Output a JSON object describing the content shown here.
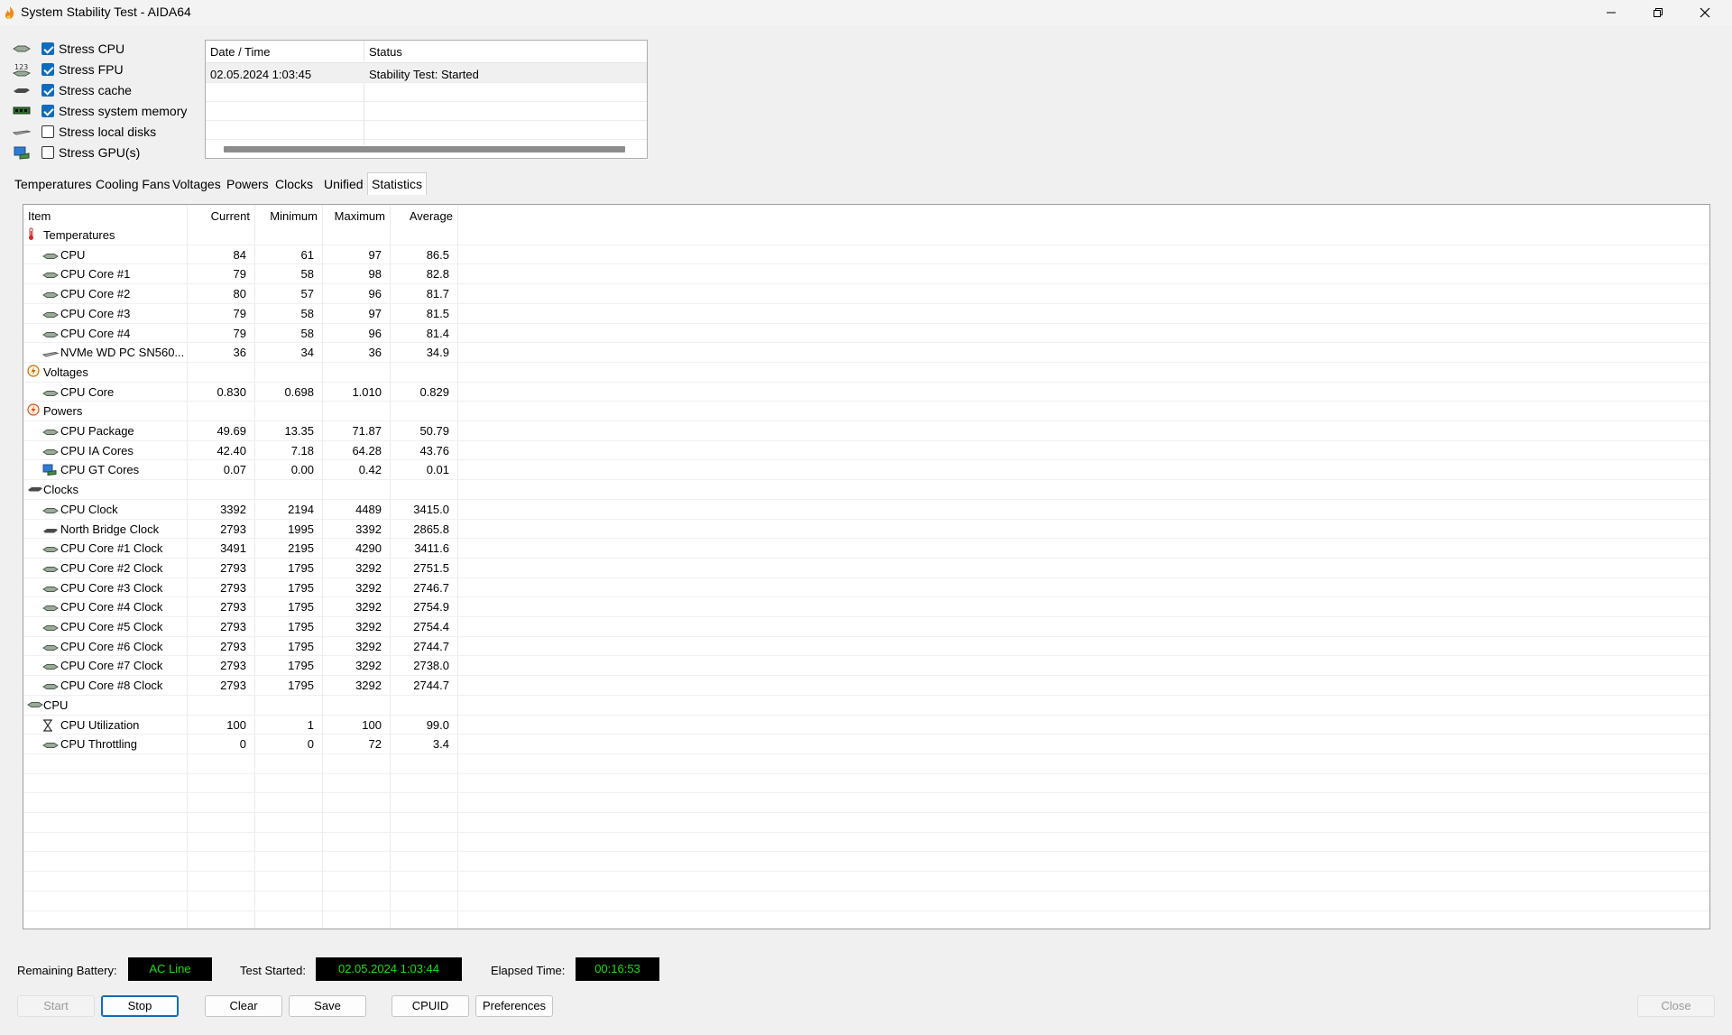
{
  "window": {
    "title": "System Stability Test - AIDA64",
    "accent": "#0f6cbd"
  },
  "stress": [
    {
      "label": "Stress CPU",
      "checked": true,
      "icon": "cpu-chip-icon"
    },
    {
      "label": "Stress FPU",
      "checked": true,
      "icon": "fpu-123-icon"
    },
    {
      "label": "Stress cache",
      "checked": true,
      "icon": "cache-icon"
    },
    {
      "label": "Stress system memory",
      "checked": true,
      "icon": "memory-module-icon"
    },
    {
      "label": "Stress local disks",
      "checked": false,
      "icon": "disk-drive-icon"
    },
    {
      "label": "Stress GPU(s)",
      "checked": false,
      "icon": "gpu-monitor-icon"
    }
  ],
  "log": {
    "headers": {
      "datetime": "Date / Time",
      "status": "Status"
    },
    "rows": [
      {
        "datetime": "02.05.2024 1:03:45",
        "status": "Stability Test: Started"
      }
    ]
  },
  "tabs": [
    "Temperatures",
    "Cooling Fans",
    "Voltages",
    "Powers",
    "Clocks",
    "Unified",
    "Statistics"
  ],
  "active_tab": "Statistics",
  "stats": {
    "headers": {
      "item": "Item",
      "current": "Current",
      "minimum": "Minimum",
      "maximum": "Maximum",
      "average": "Average"
    },
    "rows": [
      {
        "type": "group",
        "name": "Temperatures",
        "icon": "thermometer-icon"
      },
      {
        "type": "item",
        "name": "CPU",
        "icon": "cpu-chip-icon",
        "current": "84",
        "minimum": "61",
        "maximum": "97",
        "average": "86.5"
      },
      {
        "type": "item",
        "name": "CPU Core #1",
        "icon": "cpu-chip-icon",
        "current": "79",
        "minimum": "58",
        "maximum": "98",
        "average": "82.8"
      },
      {
        "type": "item",
        "name": "CPU Core #2",
        "icon": "cpu-chip-icon",
        "current": "80",
        "minimum": "57",
        "maximum": "96",
        "average": "81.7"
      },
      {
        "type": "item",
        "name": "CPU Core #3",
        "icon": "cpu-chip-icon",
        "current": "79",
        "minimum": "58",
        "maximum": "97",
        "average": "81.5"
      },
      {
        "type": "item",
        "name": "CPU Core #4",
        "icon": "cpu-chip-icon",
        "current": "79",
        "minimum": "58",
        "maximum": "96",
        "average": "81.4"
      },
      {
        "type": "item",
        "name": "NVMe WD PC SN560...",
        "icon": "disk-drive-icon",
        "current": "36",
        "minimum": "34",
        "maximum": "36",
        "average": "34.9"
      },
      {
        "type": "group",
        "name": "Voltages",
        "icon": "voltage-icon"
      },
      {
        "type": "item",
        "name": "CPU Core",
        "icon": "cpu-chip-icon",
        "current": "0.830",
        "minimum": "0.698",
        "maximum": "1.010",
        "average": "0.829"
      },
      {
        "type": "group",
        "name": "Powers",
        "icon": "power-icon"
      },
      {
        "type": "item",
        "name": "CPU Package",
        "icon": "cpu-chip-icon",
        "current": "49.69",
        "minimum": "13.35",
        "maximum": "71.87",
        "average": "50.79"
      },
      {
        "type": "item",
        "name": "CPU IA Cores",
        "icon": "cpu-chip-icon",
        "current": "42.40",
        "minimum": "7.18",
        "maximum": "64.28",
        "average": "43.76"
      },
      {
        "type": "item",
        "name": "CPU GT Cores",
        "icon": "gpu-monitor-icon",
        "current": "0.07",
        "minimum": "0.00",
        "maximum": "0.42",
        "average": "0.01"
      },
      {
        "type": "group",
        "name": "Clocks",
        "icon": "chip-dark-icon"
      },
      {
        "type": "item",
        "name": "CPU Clock",
        "icon": "cpu-chip-icon",
        "current": "3392",
        "minimum": "2194",
        "maximum": "4489",
        "average": "3415.0"
      },
      {
        "type": "item",
        "name": "North Bridge Clock",
        "icon": "chip-dark-icon",
        "current": "2793",
        "minimum": "1995",
        "maximum": "3392",
        "average": "2865.8"
      },
      {
        "type": "item",
        "name": "CPU Core #1 Clock",
        "icon": "cpu-chip-icon",
        "current": "3491",
        "minimum": "2195",
        "maximum": "4290",
        "average": "3411.6"
      },
      {
        "type": "item",
        "name": "CPU Core #2 Clock",
        "icon": "cpu-chip-icon",
        "current": "2793",
        "minimum": "1795",
        "maximum": "3292",
        "average": "2751.5"
      },
      {
        "type": "item",
        "name": "CPU Core #3 Clock",
        "icon": "cpu-chip-icon",
        "current": "2793",
        "minimum": "1795",
        "maximum": "3292",
        "average": "2746.7"
      },
      {
        "type": "item",
        "name": "CPU Core #4 Clock",
        "icon": "cpu-chip-icon",
        "current": "2793",
        "minimum": "1795",
        "maximum": "3292",
        "average": "2754.9"
      },
      {
        "type": "item",
        "name": "CPU Core #5 Clock",
        "icon": "cpu-chip-icon",
        "current": "2793",
        "minimum": "1795",
        "maximum": "3292",
        "average": "2754.4"
      },
      {
        "type": "item",
        "name": "CPU Core #6 Clock",
        "icon": "cpu-chip-icon",
        "current": "2793",
        "minimum": "1795",
        "maximum": "3292",
        "average": "2744.7"
      },
      {
        "type": "item",
        "name": "CPU Core #7 Clock",
        "icon": "cpu-chip-icon",
        "current": "2793",
        "minimum": "1795",
        "maximum": "3292",
        "average": "2738.0"
      },
      {
        "type": "item",
        "name": "CPU Core #8 Clock",
        "icon": "cpu-chip-icon",
        "current": "2793",
        "minimum": "1795",
        "maximum": "3292",
        "average": "2744.7"
      },
      {
        "type": "group",
        "name": "CPU",
        "icon": "cpu-chip-icon"
      },
      {
        "type": "item",
        "name": "CPU Utilization",
        "icon": "hourglass-icon",
        "current": "100",
        "minimum": "1",
        "maximum": "100",
        "average": "99.0"
      },
      {
        "type": "item",
        "name": "CPU Throttling",
        "icon": "cpu-chip-icon",
        "current": "0",
        "minimum": "0",
        "maximum": "72",
        "average": "3.4"
      }
    ]
  },
  "status": {
    "battery_label": "Remaining Battery:",
    "battery_value": "AC Line",
    "started_label": "Test Started:",
    "started_value": "02.05.2024 1:03:44",
    "elapsed_label": "Elapsed Time:",
    "elapsed_value": "00:16:53",
    "value_color": "#16e016"
  },
  "buttons": {
    "start": "Start",
    "stop": "Stop",
    "clear": "Clear",
    "save": "Save",
    "cpuid": "CPUID",
    "preferences": "Preferences",
    "close": "Close"
  }
}
